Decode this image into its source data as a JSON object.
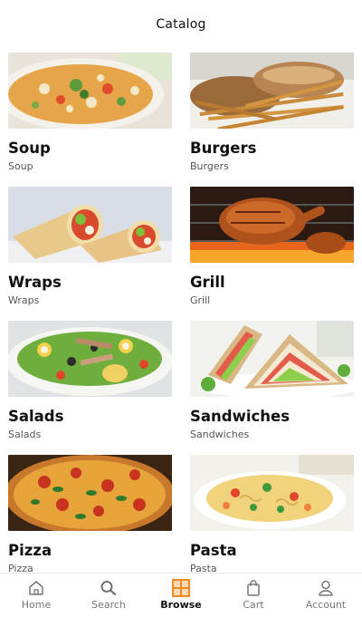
{
  "header": {
    "title": "Catalog"
  },
  "categories": [
    {
      "name": "Soup",
      "subtitle": "Soup"
    },
    {
      "name": "Burgers",
      "subtitle": "Burgers"
    },
    {
      "name": "Wraps",
      "subtitle": "Wraps"
    },
    {
      "name": "Grill",
      "subtitle": "Grill"
    },
    {
      "name": "Salads",
      "subtitle": "Salads"
    },
    {
      "name": "Sandwiches",
      "subtitle": "Sandwiches"
    },
    {
      "name": "Pizza",
      "subtitle": "Pizza"
    },
    {
      "name": "Pasta",
      "subtitle": "Pasta"
    }
  ],
  "nav": {
    "items": [
      {
        "label": "Home",
        "icon": "home-icon"
      },
      {
        "label": "Search",
        "icon": "search-icon"
      },
      {
        "label": "Browse",
        "icon": "browse-grid-icon",
        "active": true
      },
      {
        "label": "Cart",
        "icon": "cart-bag-icon"
      },
      {
        "label": "Account",
        "icon": "account-icon"
      }
    ]
  },
  "colors": {
    "accent": "#f08a24",
    "text": "#111111",
    "muted": "#777777"
  }
}
